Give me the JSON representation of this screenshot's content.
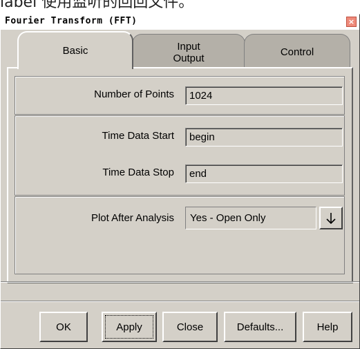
{
  "background_text": "label 使用监听的回回文件。",
  "window": {
    "title": "Fourier Transform (FFT)",
    "close_glyph": "×"
  },
  "tabs": [
    {
      "label": "Basic",
      "active": true
    },
    {
      "label": "Input\nOutput",
      "active": false
    },
    {
      "label": "Control",
      "active": false
    }
  ],
  "fields": {
    "number_of_points": {
      "label": "Number of Points",
      "value": "1024"
    },
    "time_data_start": {
      "label": "Time Data Start",
      "value": "begin"
    },
    "time_data_stop": {
      "label": "Time Data Stop",
      "value": "end"
    },
    "plot_after_analysis": {
      "label": "Plot After Analysis",
      "value": "Yes - Open Only"
    }
  },
  "buttons": {
    "ok": "OK",
    "apply": "Apply",
    "close": "Close",
    "defaults": "Defaults...",
    "help": "Help"
  },
  "colors": {
    "face": "#d4d0c8",
    "inactive_tab": "#b4b0a8",
    "close_button": "#ee8a7a"
  }
}
